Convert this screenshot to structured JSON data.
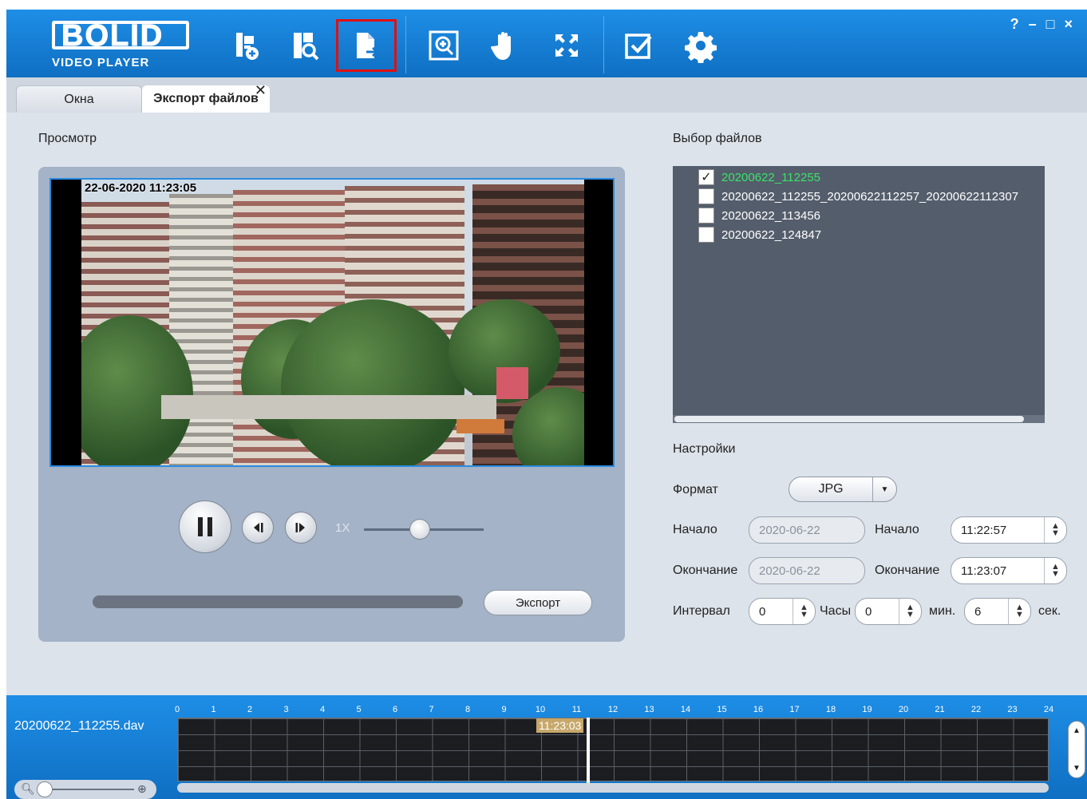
{
  "app": {
    "logo": "BOLID",
    "logo_sub": "VIDEO PLAYER",
    "toolbar": [
      {
        "name": "add-file-icon",
        "active": false
      },
      {
        "name": "search-file-icon",
        "active": false
      },
      {
        "name": "export-icon",
        "active": true
      },
      {
        "name": "zoom-in-icon",
        "active": false
      },
      {
        "name": "hand-icon",
        "active": false
      },
      {
        "name": "fullscreen-icon",
        "active": false
      },
      {
        "name": "checkbox-icon",
        "active": false
      },
      {
        "name": "gear-icon",
        "active": false
      }
    ],
    "window_controls": {
      "help": "?",
      "minimize": "–",
      "maximize": "□",
      "close": "×"
    }
  },
  "tabs": [
    {
      "label": "Окна",
      "active": false
    },
    {
      "label": "Экспорт файлов",
      "active": true
    }
  ],
  "preview": {
    "title": "Просмотр",
    "osd_timestamp": "22-06-2020 11:23:05",
    "speed_label": "1X",
    "speed_slider_value": 0.5,
    "progress_value": 1.0,
    "export_button": "Экспорт"
  },
  "files": {
    "title": "Выбор файлов",
    "items": [
      {
        "name": "20200622_112255",
        "checked": true,
        "highlight": true
      },
      {
        "name": "20200622_112255_20200622112257_20200622112307",
        "checked": false,
        "highlight": false
      },
      {
        "name": "20200622_113456",
        "checked": false,
        "highlight": false
      },
      {
        "name": "20200622_124847",
        "checked": false,
        "highlight": false
      }
    ]
  },
  "settings": {
    "title": "Настройки",
    "format_label": "Формат",
    "format_value": "JPG",
    "start_label": "Начало",
    "start_date": "2020-06-22",
    "start_time_label": "Начало",
    "start_time": "11:22:57",
    "end_label": "Окончание",
    "end_date": "2020-06-22",
    "end_time_label": "Окончание",
    "end_time": "11:23:07",
    "interval_label": "Интервал",
    "interval_hours": "0",
    "hours_label": "Часы",
    "interval_minutes": "0",
    "minutes_label": "мин.",
    "interval_seconds": "6",
    "seconds_label": "сек."
  },
  "timeline": {
    "file_name": "20200622_112255.dav",
    "hours": [
      "0",
      "1",
      "2",
      "3",
      "4",
      "5",
      "6",
      "7",
      "8",
      "9",
      "10",
      "11",
      "12",
      "13",
      "14",
      "15",
      "16",
      "17",
      "18",
      "19",
      "20",
      "21",
      "22",
      "23",
      "24"
    ],
    "cursor_time": "11:23:03"
  },
  "colors": {
    "accent": "#1e8ee6",
    "highlight_file": "#39e36b",
    "active_tool_border": "#e01010"
  }
}
